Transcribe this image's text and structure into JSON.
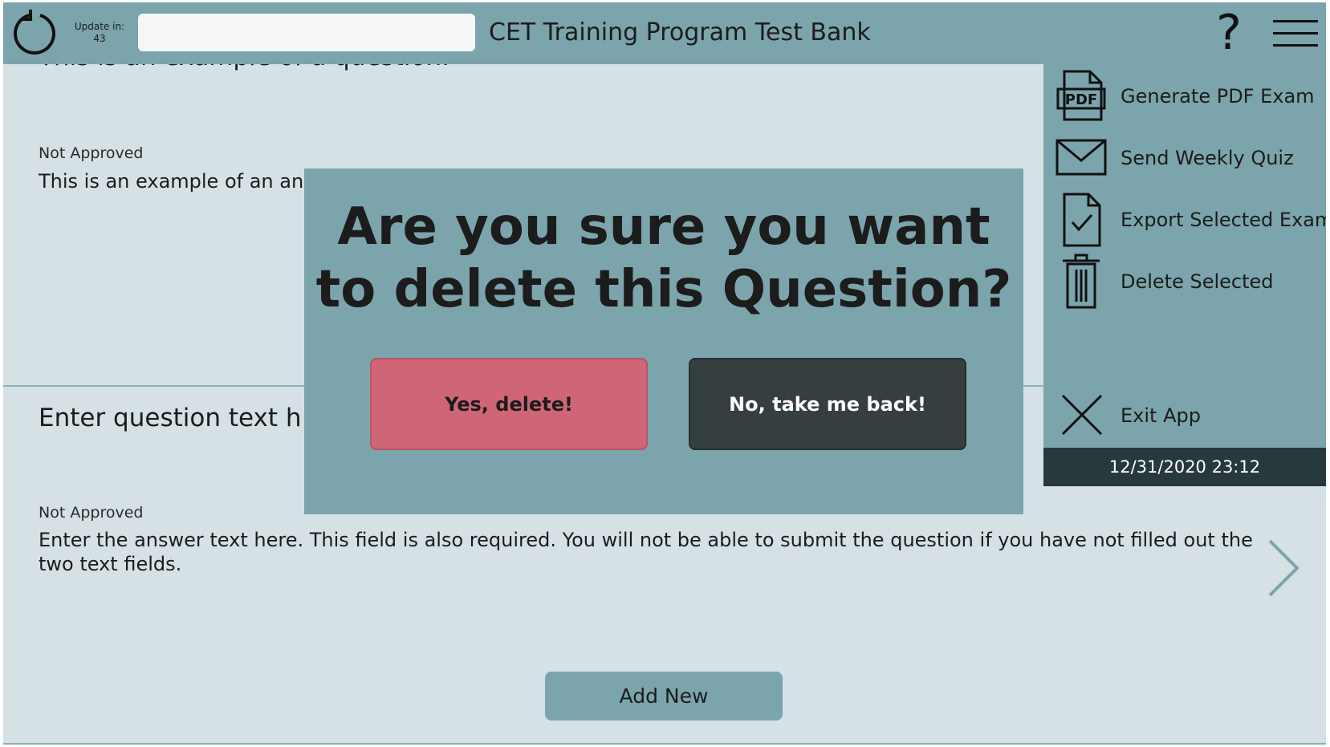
{
  "header": {
    "update_label": "Update in:",
    "update_countdown": "43",
    "search_value": "",
    "search_placeholder": "",
    "title": "CET Training Program Test Bank",
    "help_label": "?"
  },
  "questions": [
    {
      "question_text": "This is an example of a question.",
      "status": "Not Approved",
      "answer_text": "This is an example of an ans"
    },
    {
      "question_text": "Enter question text h",
      "status": "Not Approved",
      "answer_text": "Enter the answer text here. This field is also required. You will not be able to submit the question if you have not filled out the two text fields."
    }
  ],
  "add_new_label": "Add New",
  "menu": {
    "items": [
      {
        "label": "Generate PDF Exam",
        "icon": "pdf-icon"
      },
      {
        "label": "Send Weekly Quiz",
        "icon": "envelope-icon"
      },
      {
        "label": "Export Selected Exam",
        "icon": "document-check-icon"
      },
      {
        "label": "Delete Selected",
        "icon": "trash-icon"
      },
      {
        "label": "Exit App",
        "icon": "close-icon"
      }
    ],
    "timestamp": "12/31/2020 23:12"
  },
  "modal": {
    "title": "Are you sure you want to delete this Question?",
    "confirm_label": "Yes, delete!",
    "cancel_label": "No, take me back!"
  },
  "colors": {
    "accent": "#7ca4ac",
    "background": "#d5e1e4",
    "danger": "#cf6677",
    "dark": "#363f40",
    "footer": "#27393d"
  }
}
